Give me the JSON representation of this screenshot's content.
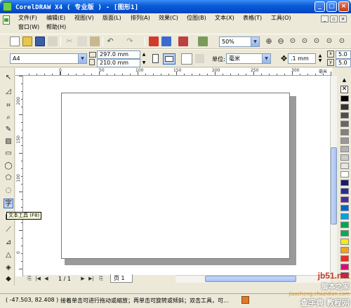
{
  "window": {
    "title": "CorelDRAW X4 ( 专业版 ) - [图形1]"
  },
  "menu": {
    "row1": [
      "文件(F)",
      "编辑(E)",
      "视图(V)",
      "版面(L)",
      "排列(A)",
      "效果(C)",
      "位图(B)",
      "文本(X)",
      "表格(T)",
      "工具(O)"
    ],
    "row2": [
      "窗口(W)",
      "帮助(H)"
    ]
  },
  "standard_toolbar": {
    "zoom_value": "50%"
  },
  "property_bar": {
    "paper_size": "A4",
    "width_value": "297.0 mm",
    "height_value": "210.0 mm",
    "unit_label": "单位:",
    "unit_value": "毫米",
    "nudge_value": ".1 mm",
    "dup_x": "5.0",
    "dup_y": "5.0"
  },
  "ruler": {
    "h_ticks": [
      "0",
      "50",
      "100",
      "150",
      "200",
      "250",
      "300"
    ],
    "h_unit": "毫米",
    "v_ticks": [
      "200",
      "150",
      "100",
      "50",
      "0"
    ]
  },
  "tooltip": {
    "text": "文本工具 (F8)"
  },
  "page_nav": {
    "counter": "1 / 1",
    "tab_label": "页 1"
  },
  "statusbar": {
    "coordinates": "( -47.503, 82.408 )",
    "hint": "接着单击可进行拖动或缩放；再单击可旋转或倾斜；双击工具，可..."
  },
  "watermark": {
    "line1": "jb51.net",
    "line2": "脚本之家",
    "line3": "jiaocheng.chazidian.com",
    "line4": "查字典 教程网"
  },
  "colors": {
    "title_bar": "#0a5ed8",
    "chrome": "#ece9d8",
    "palette": [
      "#000000",
      "#333333",
      "#4d4d4d",
      "#666666",
      "#808080",
      "#999999",
      "#b3b3b3",
      "#cccccc",
      "#e6e6e6",
      "#ffffff",
      "#1a1a6e",
      "#2b2b9a",
      "#4b2c9a",
      "#0066cc",
      "#00a0e9",
      "#00a651",
      "#00b050",
      "#f6eb14",
      "#f7a11a",
      "#ee2a24",
      "#e6007e",
      "#c2185b"
    ]
  }
}
